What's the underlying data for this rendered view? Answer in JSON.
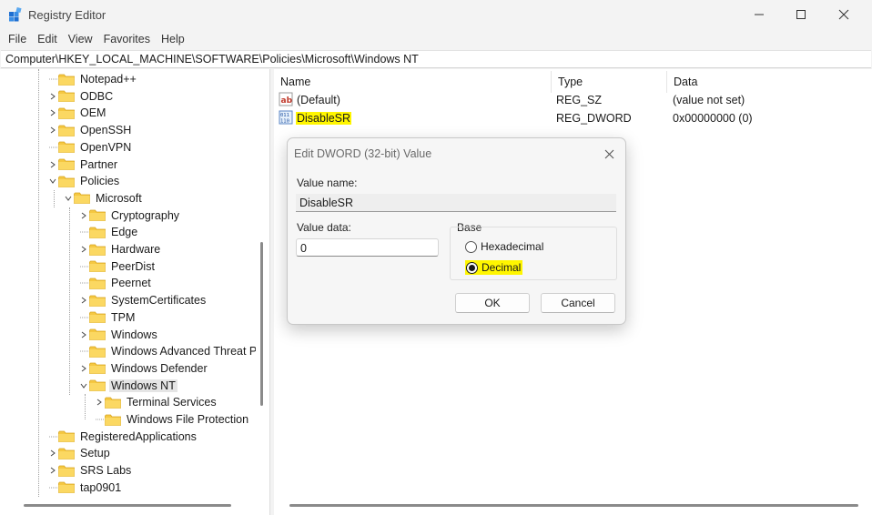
{
  "window": {
    "title": "Registry Editor"
  },
  "menu": [
    "File",
    "Edit",
    "View",
    "Favorites",
    "Help"
  ],
  "address": "Computer\\HKEY_LOCAL_MACHINE\\SOFTWARE\\Policies\\Microsoft\\Windows NT",
  "tree": [
    {
      "label": "Notepad++",
      "level": 0,
      "chevron": "none"
    },
    {
      "label": "ODBC",
      "level": 0,
      "chevron": "right"
    },
    {
      "label": "OEM",
      "level": 0,
      "chevron": "right"
    },
    {
      "label": "OpenSSH",
      "level": 0,
      "chevron": "right"
    },
    {
      "label": "OpenVPN",
      "level": 0,
      "chevron": "none"
    },
    {
      "label": "Partner",
      "level": 0,
      "chevron": "right"
    },
    {
      "label": "Policies",
      "level": 0,
      "chevron": "down"
    },
    {
      "label": "Microsoft",
      "level": 1,
      "chevron": "down"
    },
    {
      "label": "Cryptography",
      "level": 2,
      "chevron": "right"
    },
    {
      "label": "Edge",
      "level": 2,
      "chevron": "none"
    },
    {
      "label": "Hardware",
      "level": 2,
      "chevron": "right"
    },
    {
      "label": "PeerDist",
      "level": 2,
      "chevron": "none"
    },
    {
      "label": "Peernet",
      "level": 2,
      "chevron": "none"
    },
    {
      "label": "SystemCertificates",
      "level": 2,
      "chevron": "right"
    },
    {
      "label": "TPM",
      "level": 2,
      "chevron": "none"
    },
    {
      "label": "Windows",
      "level": 2,
      "chevron": "right"
    },
    {
      "label": "Windows Advanced Threat P",
      "level": 2,
      "chevron": "none"
    },
    {
      "label": "Windows Defender",
      "level": 2,
      "chevron": "right"
    },
    {
      "label": "Windows NT",
      "level": 2,
      "chevron": "down",
      "selected": true
    },
    {
      "label": "Terminal Services",
      "level": 3,
      "chevron": "right"
    },
    {
      "label": "Windows File Protection",
      "level": 3,
      "chevron": "none"
    },
    {
      "label": "RegisteredApplications",
      "level": 0,
      "chevron": "none"
    },
    {
      "label": "Setup",
      "level": 0,
      "chevron": "right"
    },
    {
      "label": "SRS Labs",
      "level": 0,
      "chevron": "right"
    },
    {
      "label": "tap0901",
      "level": 0,
      "chevron": "none"
    }
  ],
  "list": {
    "columns": {
      "name": "Name",
      "type": "Type",
      "data": "Data"
    },
    "rows": [
      {
        "name": "(Default)",
        "type": "REG_SZ",
        "data": "(value not set)",
        "icon": "string-value-icon",
        "highlight": false
      },
      {
        "name": "DisableSR",
        "type": "REG_DWORD",
        "data": "0x00000000 (0)",
        "icon": "binary-value-icon",
        "highlight": true
      }
    ]
  },
  "dialog": {
    "title": "Edit DWORD (32-bit) Value",
    "value_name_label": "Value name:",
    "value_name": "DisableSR",
    "value_data_label": "Value data:",
    "value_data": "0",
    "base_label": "Base",
    "hex_label": "Hexadecimal",
    "dec_label": "Decimal",
    "selected_base": "Decimal",
    "ok_label": "OK",
    "cancel_label": "Cancel"
  },
  "colors": {
    "highlight": "#fff600",
    "folder": "#f5c842",
    "selected_row": "#e5e5e5"
  }
}
